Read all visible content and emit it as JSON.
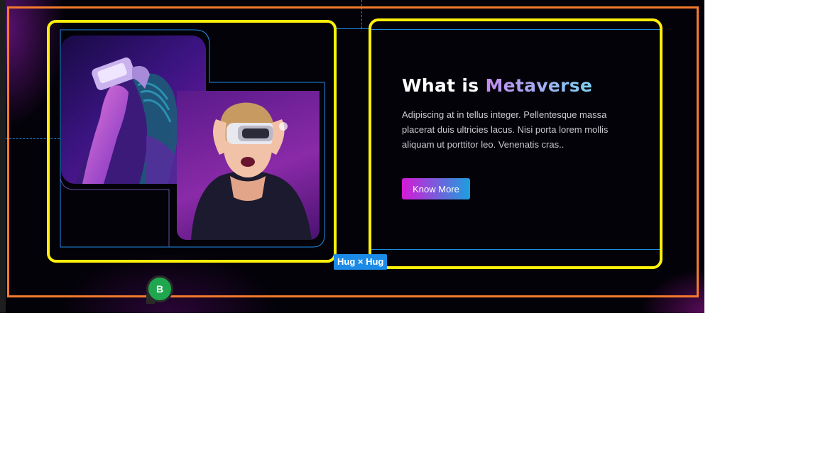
{
  "section": {
    "heading_prefix": "What is",
    "heading_accent": "Metaverse",
    "description": "Adipiscing at in tellus integer. Pellentesque massa placerat duis ultricies lacus. Nisi porta lorem mollis aliquam ut porttitor leo. Venenatis cras..",
    "button_label": "Know More"
  },
  "editor": {
    "size_badge": "Hug × Hug",
    "user_avatar_initial": "B"
  },
  "colors": {
    "selection_outline": "#ffef0a",
    "frame_outline": "#f47a2c",
    "guide_blue": "#1c8be8",
    "button_gradient_start": "#d51ad6",
    "button_gradient_end": "#1c9fe0",
    "avatar_green": "#1fa74f"
  },
  "icons": {
    "photo_1": "woman-vr-headset-image",
    "photo_2": "person-vr-headset-smiling-image"
  }
}
